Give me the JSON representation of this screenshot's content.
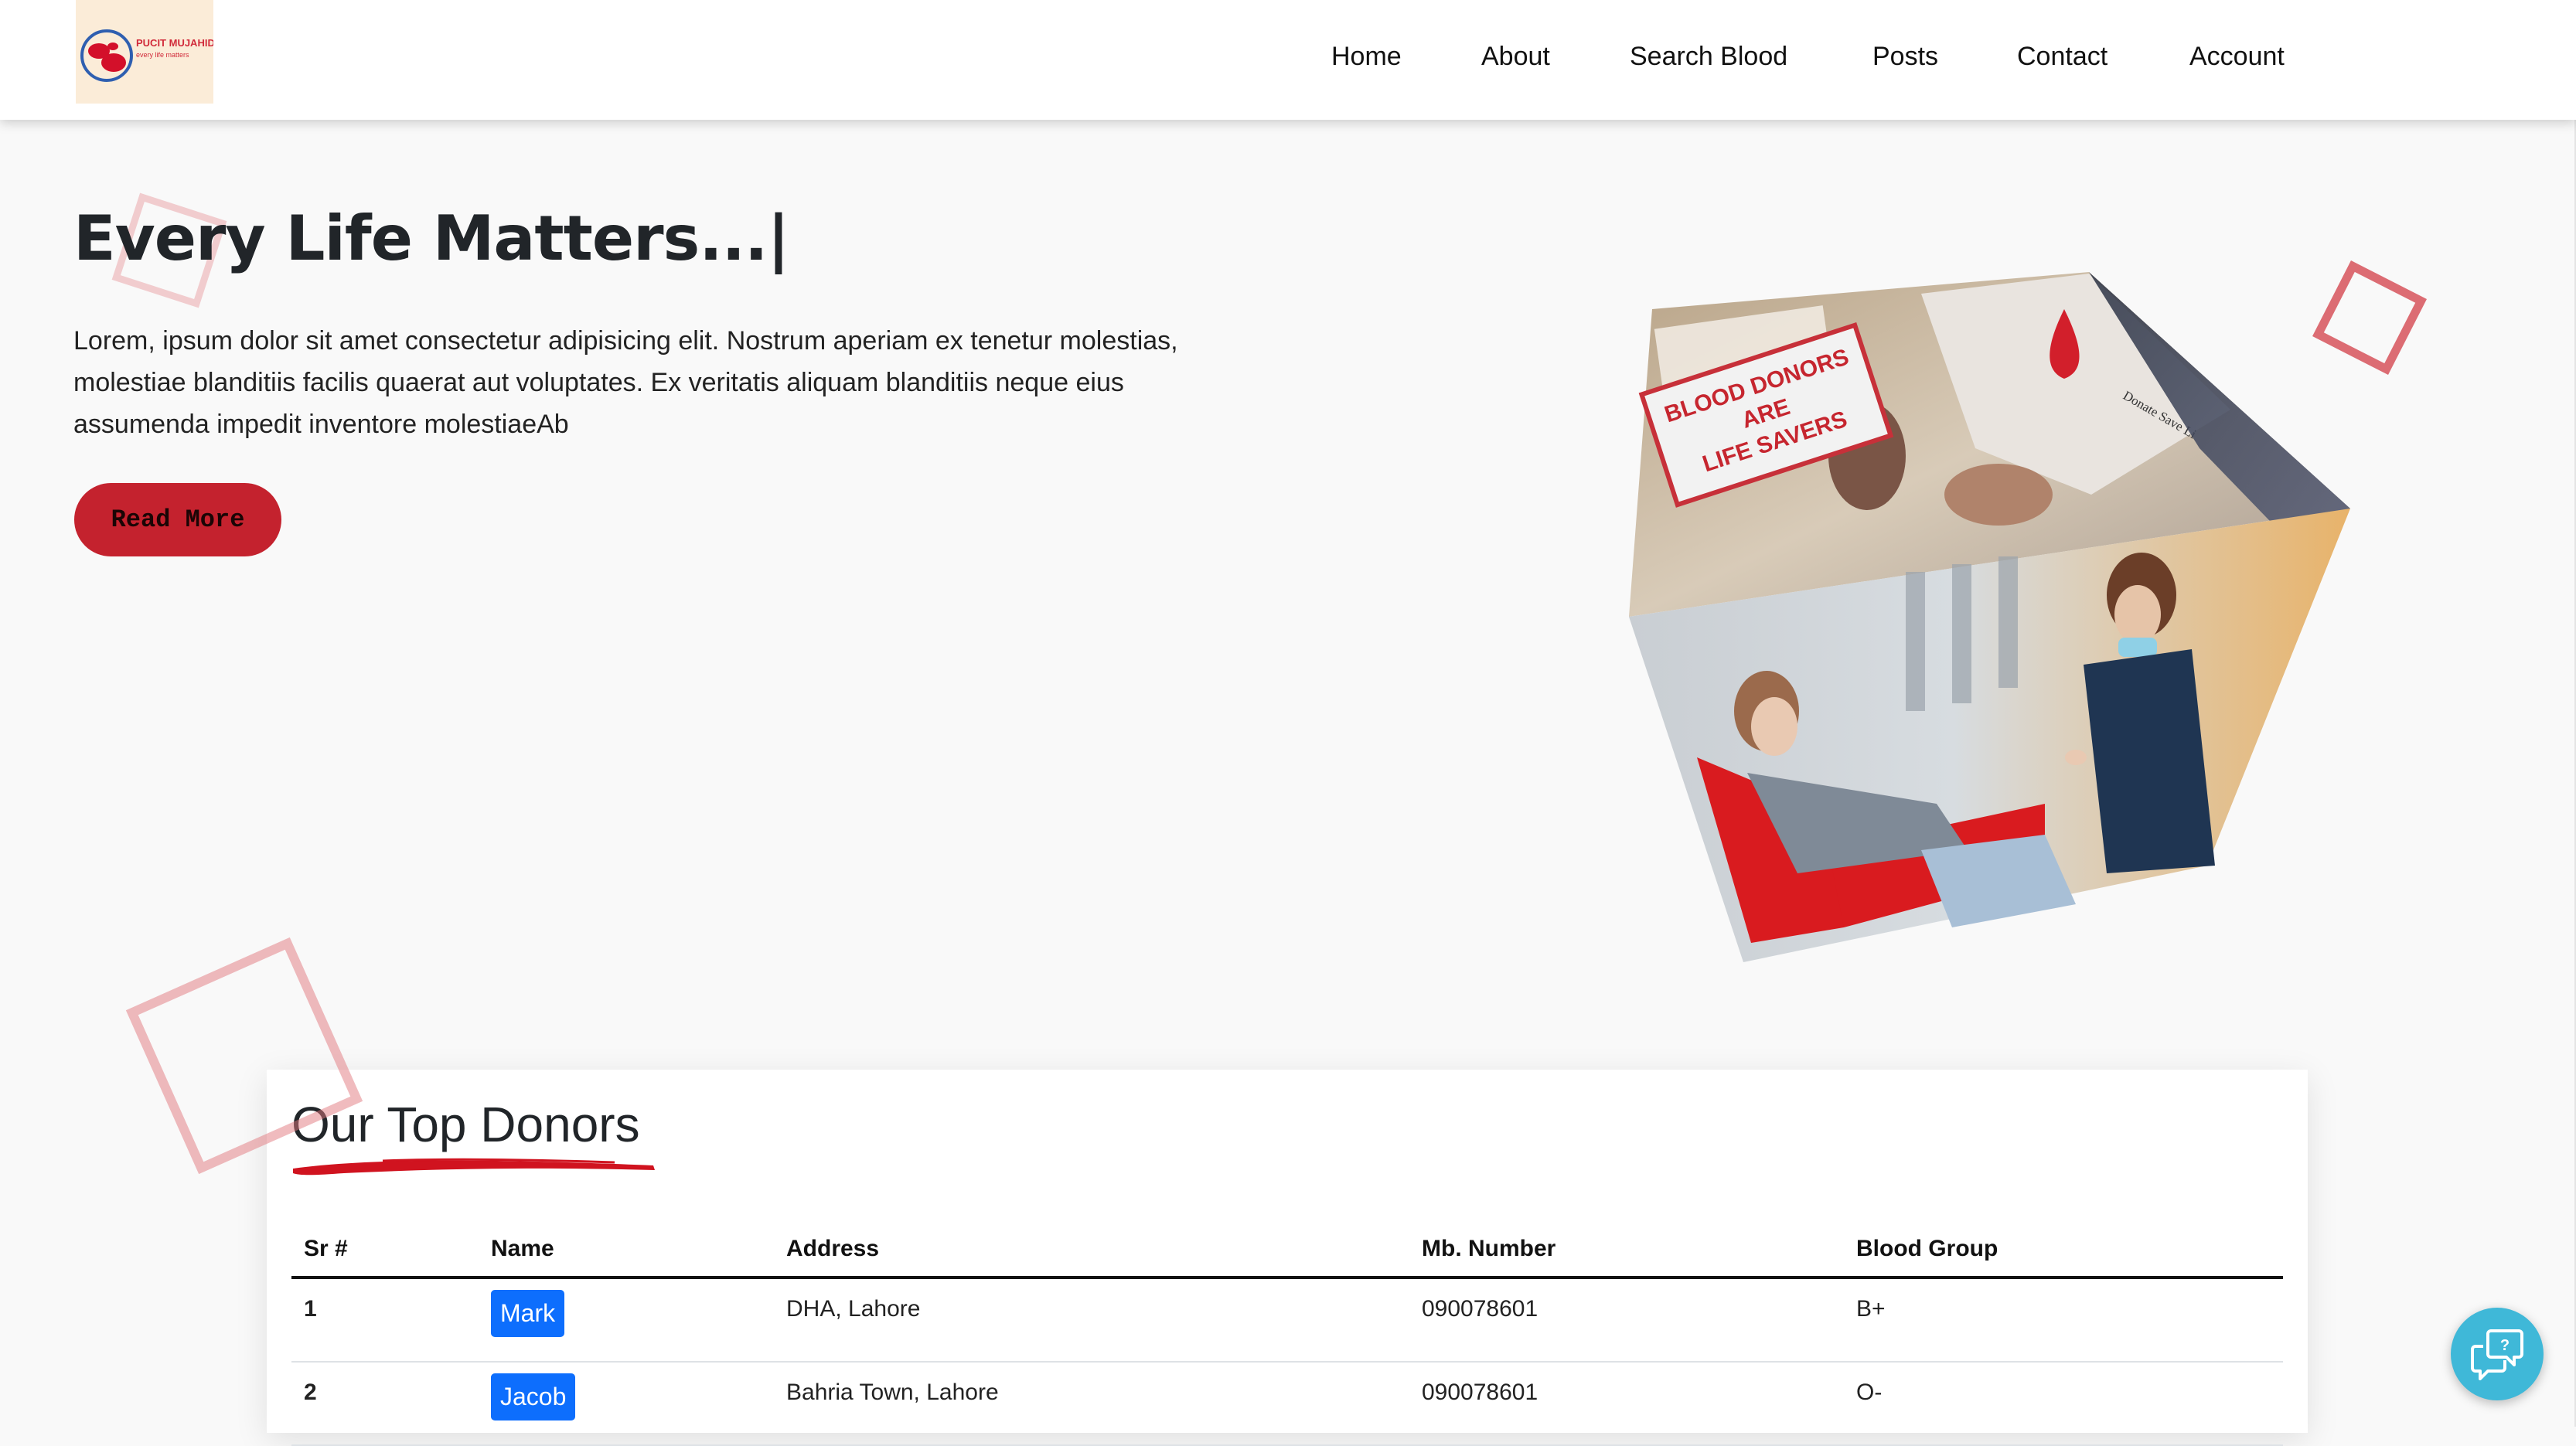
{
  "logo": {
    "title": "PUCIT MUJAHIDS",
    "tagline": "every life matters"
  },
  "nav": {
    "items": [
      "Home",
      "About",
      "Search Blood",
      "Posts",
      "Contact",
      "Account"
    ]
  },
  "hero": {
    "title": "Every Life Matters...",
    "cursor": "|",
    "text": "Lorem, ipsum dolor sit amet consectetur adipisicing elit. Nostrum aperiam ex tenetur molestias, molestiae blanditiis facilis quaerat aut voluptates. Ex veritatis aliquam blanditiis neque eius assumenda impedit inventore molestiaeAb",
    "button": "Read More"
  },
  "cube": {
    "sign_line1": "BLOOD DONORS",
    "sign_line2": "ARE",
    "sign_line3": "LIFE SAVERS",
    "shirt_text": "Donate Save Li"
  },
  "donors": {
    "title": "Our Top Donors",
    "columns": [
      "Sr #",
      "Name",
      "Address",
      "Mb. Number",
      "Blood Group"
    ],
    "rows": [
      {
        "sr": "1",
        "name": "Mark",
        "address": "DHA, Lahore",
        "mobile": "090078601",
        "group": "B+"
      },
      {
        "sr": "2",
        "name": "Jacob",
        "address": "Bahria Town, Lahore",
        "mobile": "090078601",
        "group": "O-"
      }
    ]
  },
  "colors": {
    "accent_red": "#c4222e",
    "name_blue": "#0d6efd",
    "chat_cyan": "#3fb8d8"
  },
  "icons": {
    "chat": "chat-help-icon"
  }
}
